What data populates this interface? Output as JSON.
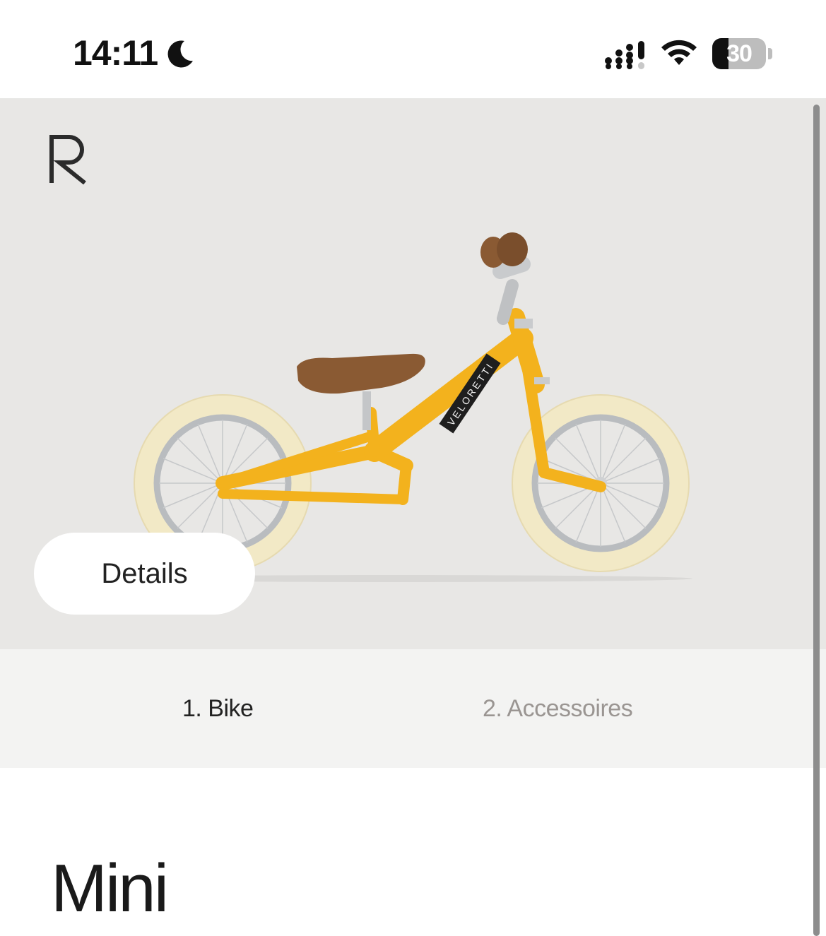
{
  "status_bar": {
    "time": "14:11",
    "battery_level": "30",
    "icons": [
      "moon-icon",
      "signal-icon",
      "wifi-icon",
      "battery-icon"
    ]
  },
  "hero": {
    "logo": "R",
    "bike_brand": "VELORETTI",
    "details_label": "Details",
    "colors": {
      "background": "#e8e7e5",
      "frame": "#f3b21d",
      "tire": "#f2e9c6",
      "saddle": "#8a5a33"
    }
  },
  "steps": {
    "step1": "1. Bike",
    "step2": "2. Accessoires"
  },
  "product": {
    "title": "Mini"
  }
}
